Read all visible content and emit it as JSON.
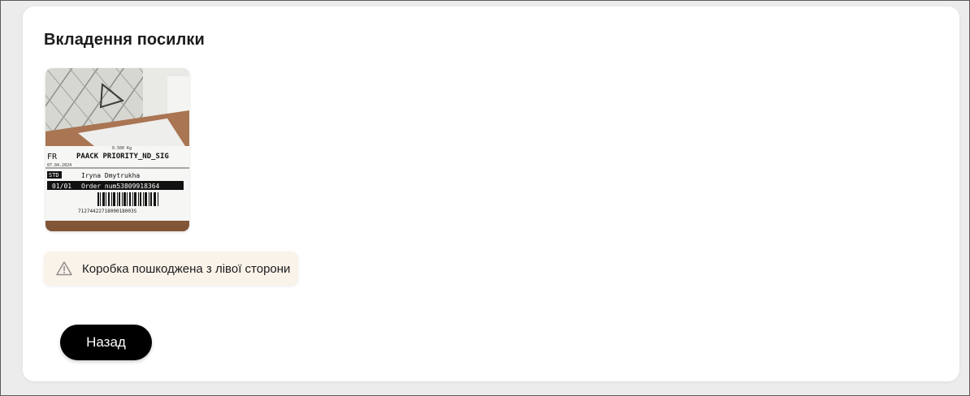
{
  "section": {
    "title": "Вкладення посилки"
  },
  "attachment": {
    "label": {
      "country": "FR",
      "service": "PAACK PRIORITY_ND_SIG",
      "date": "07.04.2024",
      "weight": "0.500 Kg",
      "type": "STD",
      "recipient": "Iryna Dmytrukha",
      "pieces": "01/01",
      "order": "Order num53809918364",
      "barcode_number": "7127442271800018003S"
    }
  },
  "damage_note": {
    "icon": "warning-triangle-icon",
    "text": "Коробка пошкоджена з лівої сторони"
  },
  "actions": {
    "back_label": "Назад"
  }
}
